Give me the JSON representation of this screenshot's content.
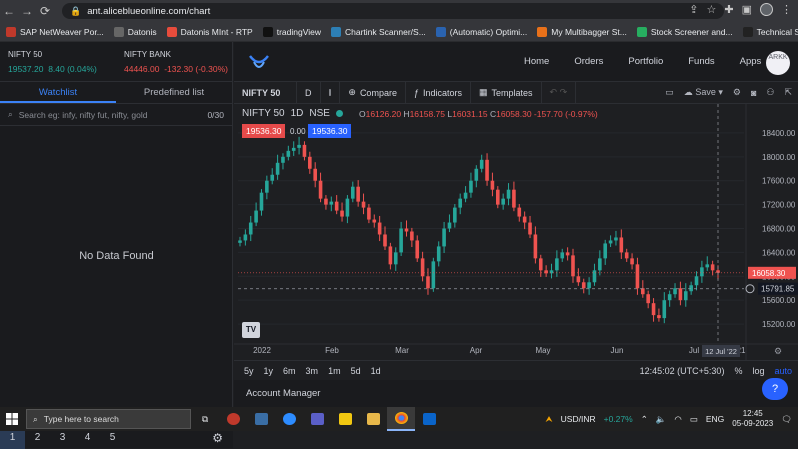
{
  "browser": {
    "url": "ant.aliceblueonline.com/chart",
    "bookmarks": [
      {
        "label": "SAP NetWeaver Por...",
        "color": "#c0392b"
      },
      {
        "label": "Datonis",
        "color": "#666666"
      },
      {
        "label": "Datonis MInt - RTP",
        "color": "#e74c3c"
      },
      {
        "label": "tradingView",
        "color": "#111111"
      },
      {
        "label": "Chartink Scanner/S...",
        "color": "#2d7fb5"
      },
      {
        "label": "(Automatic) Optimi...",
        "color": "#2a63b0"
      },
      {
        "label": "My Multibagger St...",
        "color": "#e8711a"
      },
      {
        "label": "Stock Screener and...",
        "color": "#27ae60"
      },
      {
        "label": "Technical Stock Scr...",
        "color": "#222222"
      }
    ]
  },
  "indices": [
    {
      "name": "NIFTY 50",
      "value": "19537.20",
      "change": "8.40 (0.04%)",
      "direction": "up"
    },
    {
      "name": "NIFTY BANK",
      "value": "44446.00",
      "change": "-132.30 (-0.30%)",
      "direction": "down"
    }
  ],
  "watchlist": {
    "tabs": [
      "Watchlist",
      "Predefined list"
    ],
    "search_placeholder": "Search eg: infy, nifty fut, nifty, gold",
    "count": "0/30",
    "empty_text": "No Data Found",
    "pages": [
      "1",
      "2",
      "3",
      "4",
      "5"
    ]
  },
  "header": {
    "nav": [
      "Home",
      "Orders",
      "Portfolio",
      "Funds",
      "Apps"
    ],
    "avatar": "ARKK"
  },
  "toolbar": {
    "symbol": "NIFTY 50",
    "interval": "D",
    "compare": "Compare",
    "indicators": "Indicators",
    "templates": "Templates",
    "save": "Save"
  },
  "chart_header": {
    "symbol": "NIFTY 50",
    "interval": "1D",
    "exchange": "NSE",
    "o": "16126.20",
    "h": "16158.75",
    "l": "16031.15",
    "c": "16058.30",
    "chg": "-157.70 (-0.97%)",
    "sell": "19536.30",
    "spread": "0.00",
    "buy": "19536.30"
  },
  "chart_data": {
    "type": "candlestick",
    "y_ticks": [
      15200,
      15600,
      16000,
      16400,
      16800,
      17200,
      17600,
      18000,
      18400
    ],
    "ylim": [
      14900,
      18650
    ],
    "x_labels": [
      "2022",
      "Feb",
      "Mar",
      "Apr",
      "May",
      "Jun",
      "Jul",
      "21"
    ],
    "last_price_label": "16058.30",
    "crosshair_price_label": "15791.85",
    "crosshair_date_label": "12 Jul '22",
    "closes": [
      16600,
      16700,
      16900,
      17100,
      17400,
      17600,
      17700,
      17900,
      18000,
      18100,
      18150,
      18200,
      18000,
      17800,
      17600,
      17300,
      17200,
      17250,
      17100,
      17000,
      17300,
      17500,
      17250,
      17150,
      16950,
      16900,
      16700,
      16500,
      16200,
      16400,
      16800,
      16750,
      16600,
      16300,
      16000,
      15800,
      16250,
      16500,
      16800,
      16900,
      17150,
      17300,
      17400,
      17600,
      17800,
      17950,
      17600,
      17450,
      17200,
      17300,
      17450,
      17150,
      17000,
      16900,
      16700,
      16300,
      16100,
      16050,
      16100,
      16300,
      16400,
      16350,
      16000,
      15900,
      15800,
      15900,
      16100,
      16300,
      16550,
      16600,
      16650,
      16400,
      16300,
      16200,
      15800,
      15700,
      15550,
      15350,
      15300,
      15600,
      15700,
      15800,
      15600,
      15750,
      15850,
      16000,
      16150,
      16200,
      16100,
      16058
    ]
  },
  "timeframes": [
    "5y",
    "1y",
    "6m",
    "3m",
    "1m",
    "5d",
    "1d"
  ],
  "status": {
    "time": "12:45:02 (UTC+5:30)",
    "pct": "%",
    "log": "log",
    "auto": "auto"
  },
  "account_bar": "Account Manager",
  "taskbar": {
    "search_placeholder": "Type here to search",
    "ticker_symbol": "USD/INR",
    "ticker_change": "+0.27%",
    "lang": "ENG",
    "time": "12:45",
    "date": "05-09-2023"
  },
  "colors": {
    "up": "#26a69a",
    "down": "#ef5350",
    "accent": "#2962ff"
  }
}
